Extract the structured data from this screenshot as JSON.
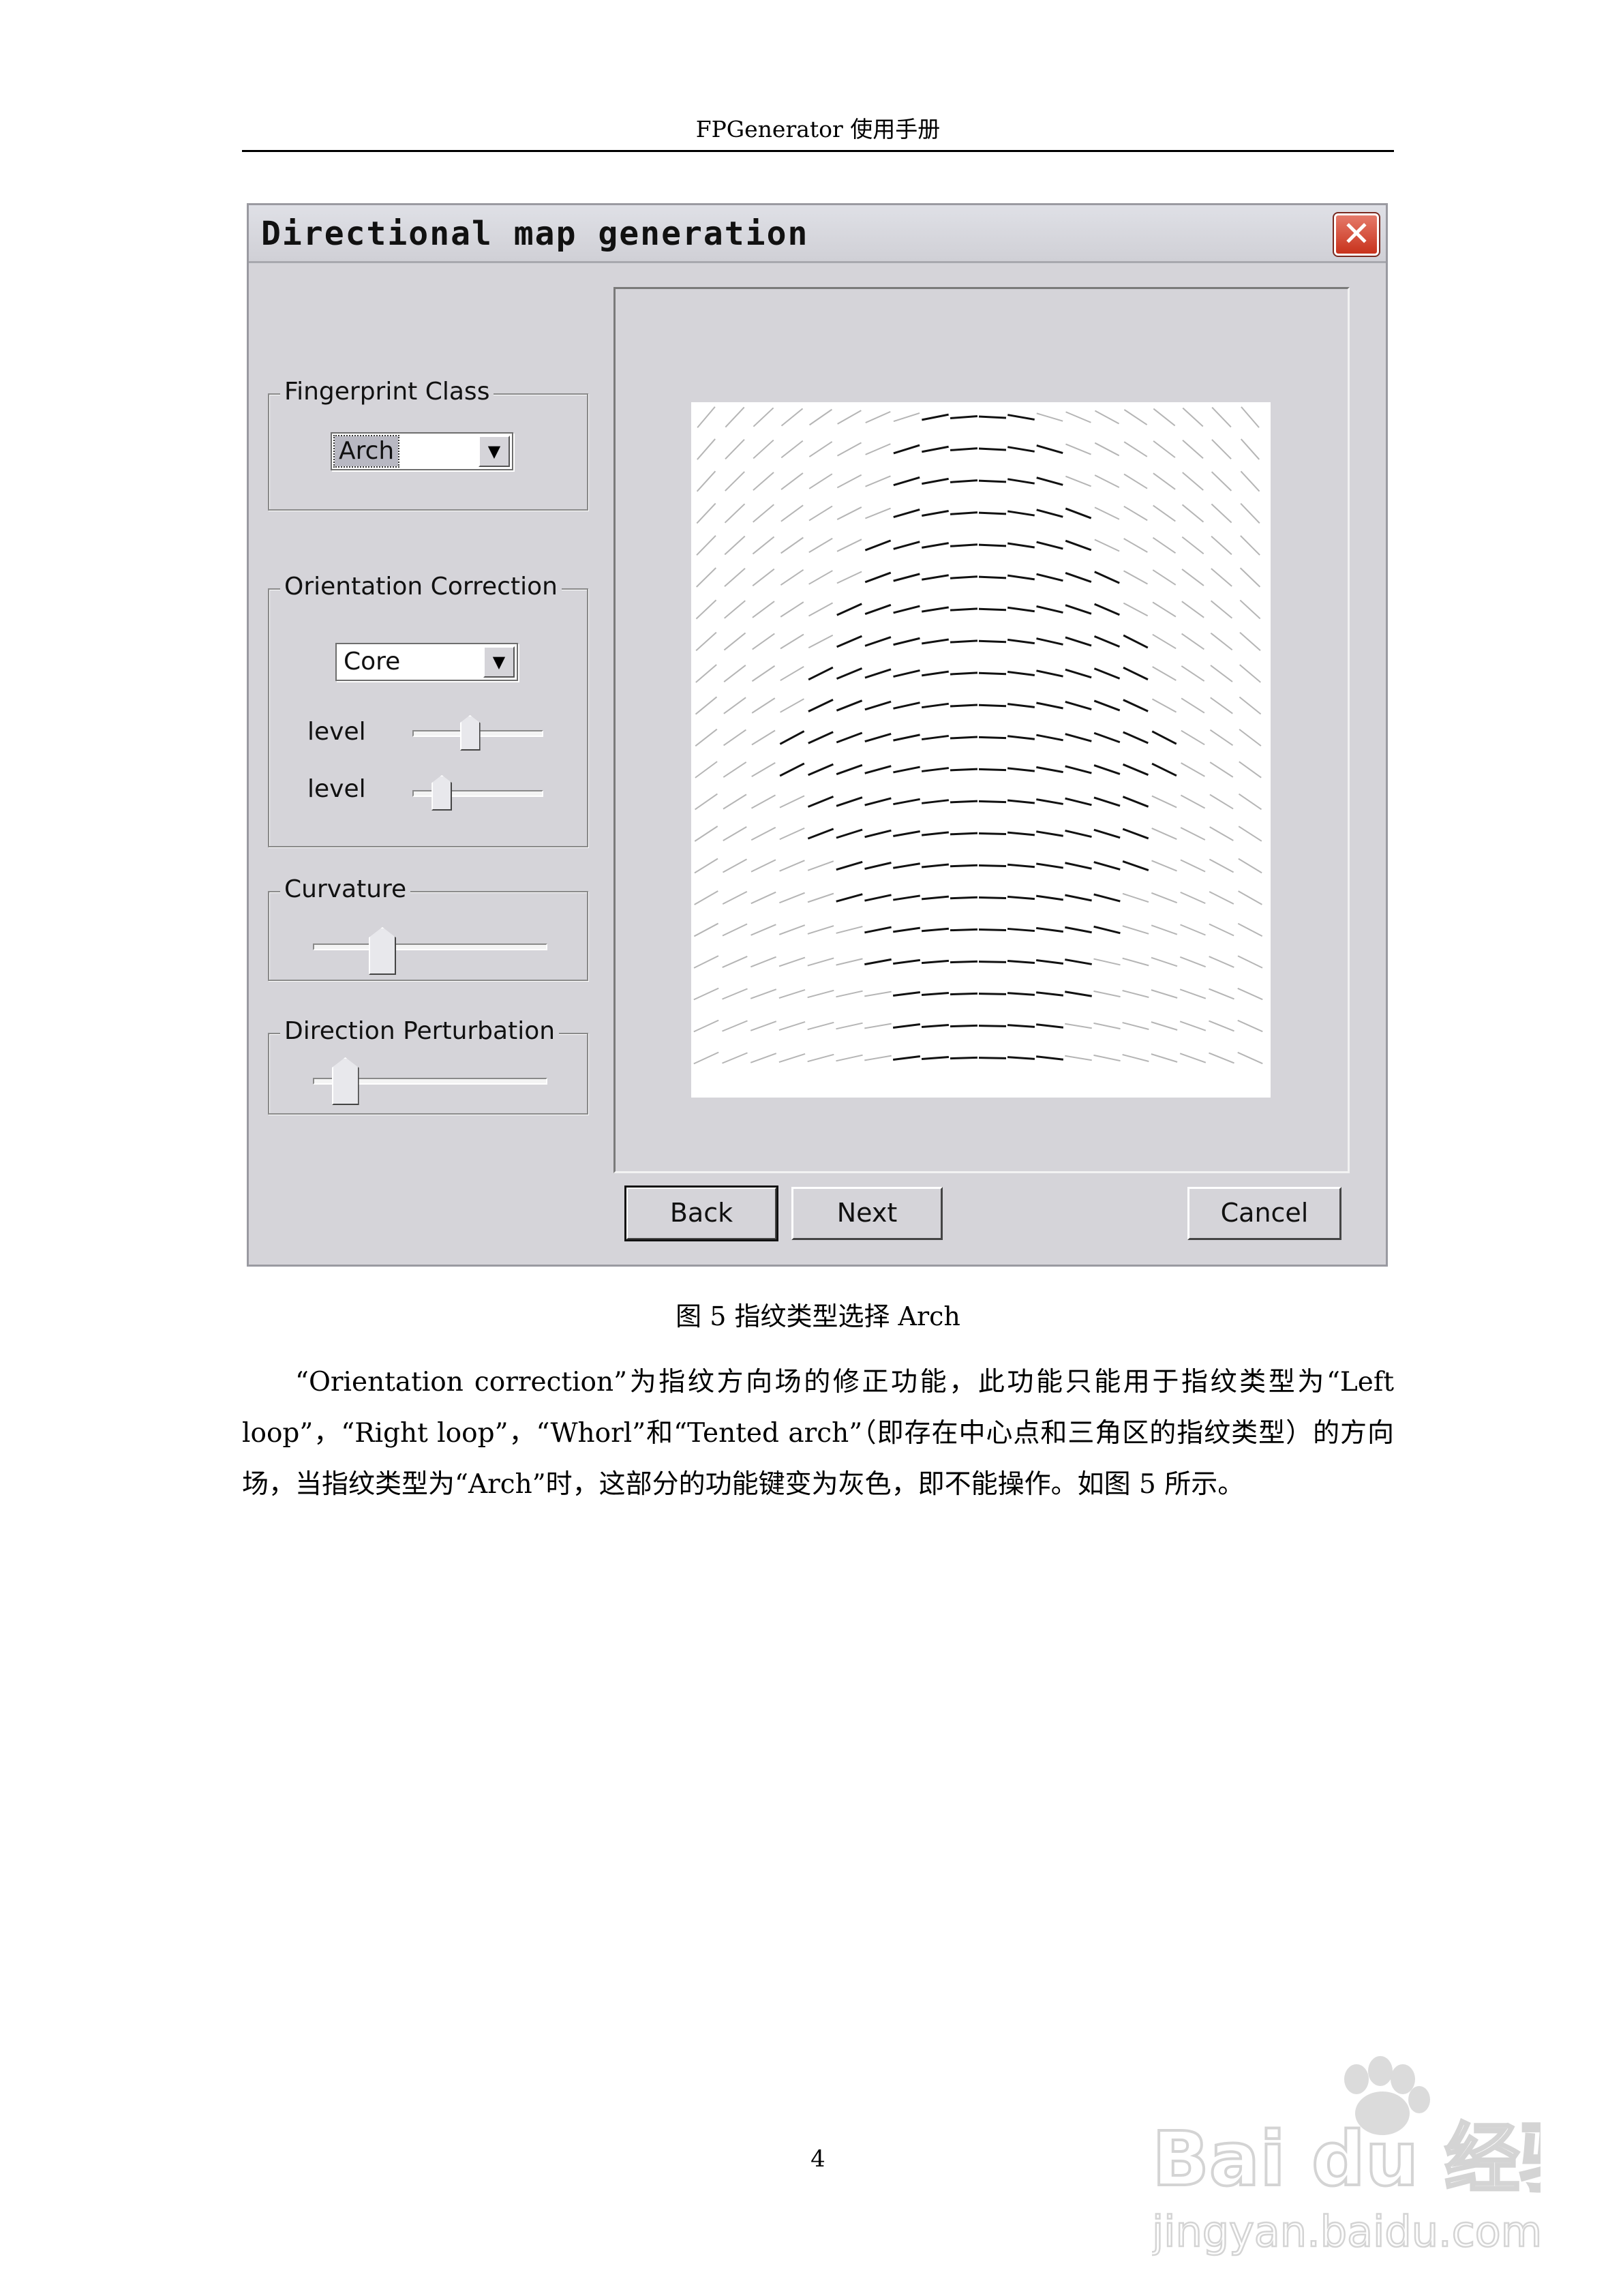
{
  "page": {
    "header": "FPGenerator 使用手册",
    "page_number": "4"
  },
  "dialog": {
    "title": "Directional map generation",
    "close_glyph": "✕",
    "fingerprint_class": {
      "legend": "Fingerprint Class",
      "value": "Arch"
    },
    "orientation_correction": {
      "legend": "Orientation Correction",
      "value": "Core",
      "level1_label": "level",
      "level1_value": 0.45,
      "level2_label": "level",
      "level2_value": 0.23
    },
    "curvature": {
      "legend": "Curvature",
      "value": 0.3
    },
    "direction_perturbation": {
      "legend": "Direction Perturbation",
      "value": 0.14
    },
    "buttons": {
      "back": "Back",
      "next": "Next",
      "cancel": "Cancel"
    },
    "arrow_glyph": "▼"
  },
  "figure": {
    "caption": "图 5  指纹类型选择 Arch"
  },
  "body": {
    "paragraph": "“Orientation correction”为指纹方向场的修正功能，此功能只能用于指纹类型为“Left loop”，“Right loop”，“Whorl”和“Tented arch”（即存在中心点和三角区的指纹类型）的方向场，当指纹类型为“Arch”时，这部分的功能键变为灰色，即不能操作。如图 5 所示。"
  },
  "watermark": {
    "brand": "Bai du 经验",
    "url": "jingyan.baidu.com"
  },
  "colors": {
    "dialog_bg": "#d5d4d9",
    "close_red": "#c8321c"
  }
}
